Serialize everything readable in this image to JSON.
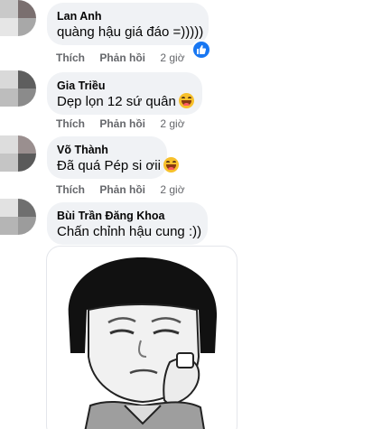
{
  "comments": [
    {
      "author": "Lan Anh",
      "text": "quàng hậu giá đáo =)))))",
      "reaction": "like-icon",
      "actions": {
        "like": "Thích",
        "reply": "Phản hồi",
        "time": "2 giờ"
      }
    },
    {
      "author": "Gia Triều",
      "text": "Dẹp lọn 12 sứ quân",
      "emoji": "laughing-emoji",
      "actions": {
        "like": "Thích",
        "reply": "Phản hồi",
        "time": "2 giờ"
      }
    },
    {
      "author": "Võ Thành",
      "text": "Đã quá Pép si ơii",
      "emoji": "laughing-emoji",
      "actions": {
        "like": "Thích",
        "reply": "Phản hồi",
        "time": "2 giờ"
      }
    },
    {
      "author": "Bùi Trần Đăng Khoa",
      "text": "Chấn chỉnh hậu cung :))",
      "attachment": "meme-sticker"
    }
  ],
  "colors": {
    "bubble": "#f0f2f5",
    "meta_text": "#65676b",
    "like_blue": "#1877f2"
  }
}
